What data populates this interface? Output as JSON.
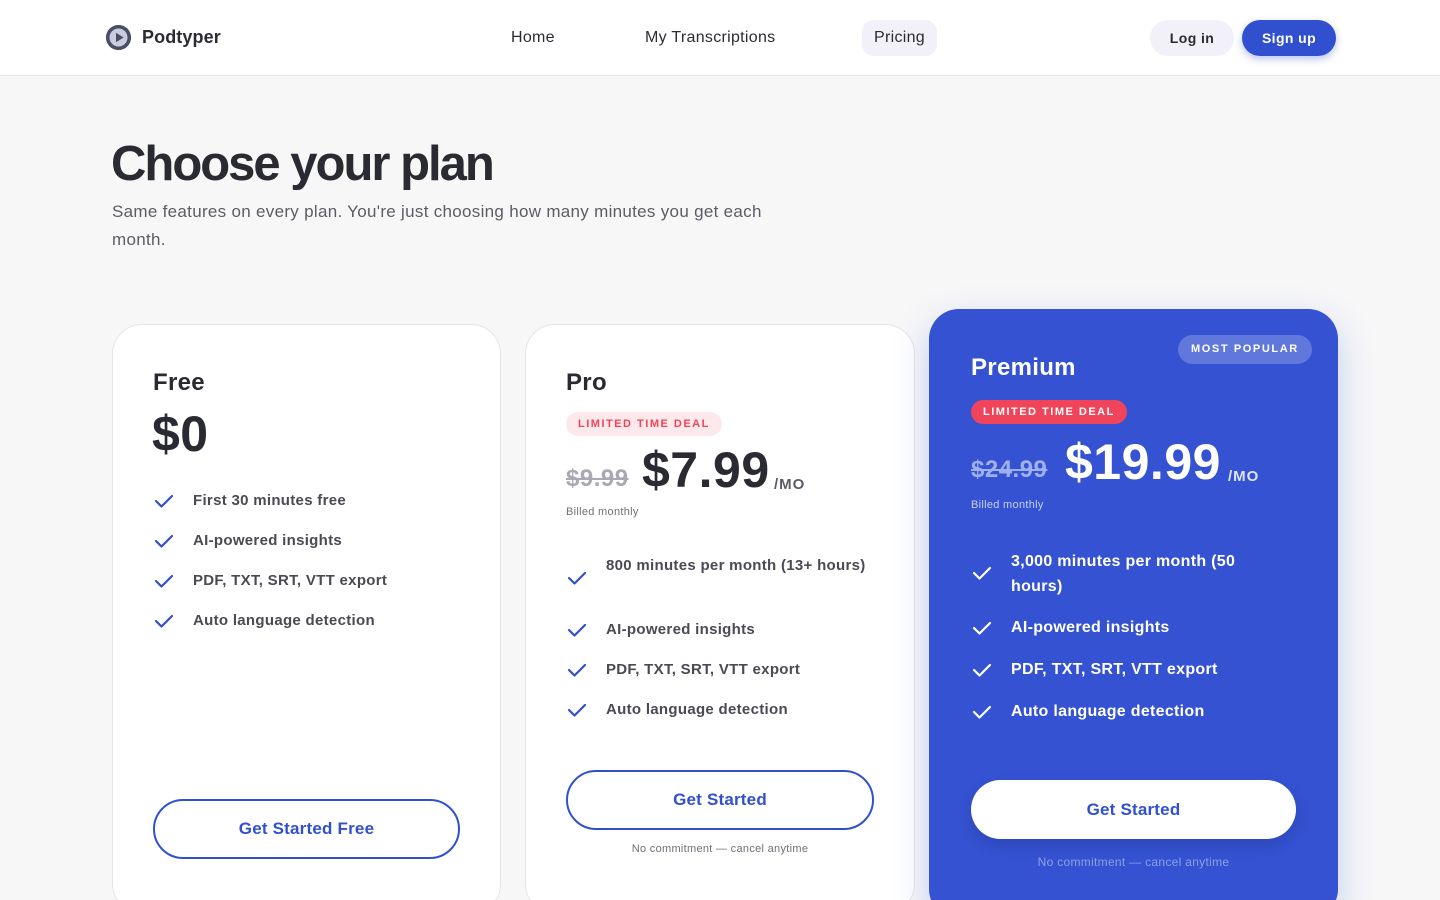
{
  "header": {
    "brand": "Podtyper",
    "nav": [
      {
        "label": "Home"
      },
      {
        "label": "My Transcriptions"
      },
      {
        "label": "Pricing",
        "active": true
      }
    ],
    "login": "Log in",
    "signup": "Sign up"
  },
  "hero": {
    "title": "Choose your plan",
    "subtitle": "Same features on every plan. You're just choosing how many minutes you get each month."
  },
  "plans": [
    {
      "name": "Free",
      "price": "$0",
      "features": [
        "First 30 minutes free",
        "AI-powered insights",
        "PDF, TXT, SRT, VTT export",
        "Auto language detection"
      ],
      "cta": "Get Started Free"
    },
    {
      "name": "Pro",
      "badge": "LIMITED TIME DEAL",
      "old_price": "$9.99",
      "price": "$7.99",
      "per": "/MO",
      "billed": "Billed monthly",
      "features": [
        "800 minutes per month (13+ hours)",
        "AI-powered insights",
        "PDF, TXT, SRT, VTT export",
        "Auto language detection"
      ],
      "cta": "Get Started",
      "note": "No commitment — cancel anytime"
    },
    {
      "name": "Premium",
      "popular": "MOST POPULAR",
      "badge": "LIMITED TIME DEAL",
      "old_price": "$24.99",
      "price": "$19.99",
      "per": "/MO",
      "billed": "Billed monthly",
      "features": [
        "3,000 minutes per month (50 hours)",
        "AI-powered insights",
        "PDF, TXT, SRT, VTT export",
        "Auto language detection"
      ],
      "cta": "Get Started",
      "note": "No commitment — cancel anytime"
    }
  ],
  "colors": {
    "accent": "#3150d0",
    "premium_bg": "#3452d1",
    "deal_red": "#f0445a",
    "deal_bg": "#fde8ec",
    "page_bg": "#f7f7f8"
  },
  "icons": {
    "logo": "play-circle-icon",
    "feature": "check-icon"
  }
}
